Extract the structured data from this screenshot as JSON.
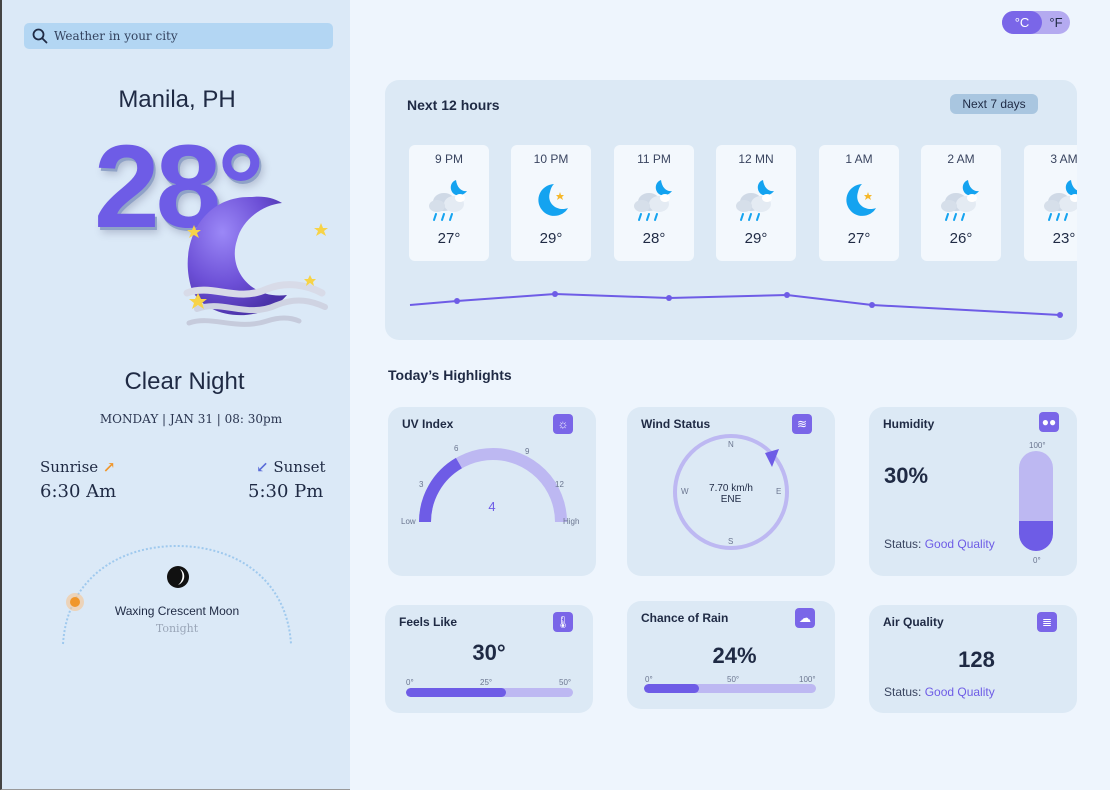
{
  "search": {
    "placeholder": "Weather in your city"
  },
  "location": "Manila, PH",
  "current": {
    "temp": "28°",
    "condition": "Clear Night",
    "date": "MONDAY | JAN 31 | 08: 30pm"
  },
  "sun": {
    "sunrise_label": "Sunrise",
    "sunrise_time": "6:30 Am",
    "sunset_label": "Sunset",
    "sunset_time": "5:30 Pm"
  },
  "moon": {
    "phase": "Waxing Crescent Moon",
    "when": "Tonight"
  },
  "units": {
    "celsius": "°C",
    "fahrenheit": "°F",
    "selected": "celsius"
  },
  "hourly": {
    "title": "Next 12 hours",
    "button": "Next 7 days",
    "items": [
      {
        "time": "9 PM",
        "temp": "27°",
        "icon": "cloud-moon-rain-icon"
      },
      {
        "time": "10 PM",
        "temp": "29°",
        "icon": "moon-star-icon"
      },
      {
        "time": "11 PM",
        "temp": "28°",
        "icon": "cloud-moon-rain-icon"
      },
      {
        "time": "12  MN",
        "temp": "29°",
        "icon": "cloud-moon-rain-icon"
      },
      {
        "time": "1 AM",
        "temp": "27°",
        "icon": "moon-star-icon"
      },
      {
        "time": "2 AM",
        "temp": "26°",
        "icon": "cloud-moon-rain-icon"
      },
      {
        "time": "3 AM",
        "temp": "23°",
        "icon": "cloud-moon-rain-icon"
      }
    ]
  },
  "highlights": {
    "title": "Today’s Highlights",
    "uv": {
      "title": "UV Index",
      "value": "4",
      "fraction": 0.333,
      "ticks": [
        "3",
        "6",
        "9",
        "12"
      ],
      "low": "Low",
      "high": "High",
      "icon": "sun-icon"
    },
    "wind": {
      "title": "Wind Status",
      "speed": "7.70 km/h",
      "direction": "ENE",
      "n": "N",
      "e": "E",
      "s": "S",
      "w": "W",
      "icon": "wind-icon"
    },
    "humidity": {
      "title": "Humidity",
      "value": "30%",
      "fraction": 0.3,
      "max": "100°",
      "min": "0°",
      "status_label": "Status: ",
      "status_value": "Good Quality",
      "icon": "droplets-icon"
    },
    "feels": {
      "title": "Feels Like",
      "value": "30°",
      "fraction": 0.6,
      "min": "0°",
      "mid": "25°",
      "max": "50°",
      "icon": "thermometer-icon"
    },
    "rain": {
      "title": "Chance of Rain",
      "value": "24%",
      "fraction": 0.32,
      "min": "0°",
      "mid": "50°",
      "max": "100°",
      "icon": "cloud-rain-icon"
    },
    "air": {
      "title": "Air Quality",
      "value": "128",
      "status_label": "Status: ",
      "status_value": "Good Quality",
      "icon": "air-icon"
    }
  },
  "colors": {
    "accent": "#6e5ce6",
    "panel": "#dbe9f7",
    "card": "#dce9f5",
    "sun": "#f0962a"
  }
}
